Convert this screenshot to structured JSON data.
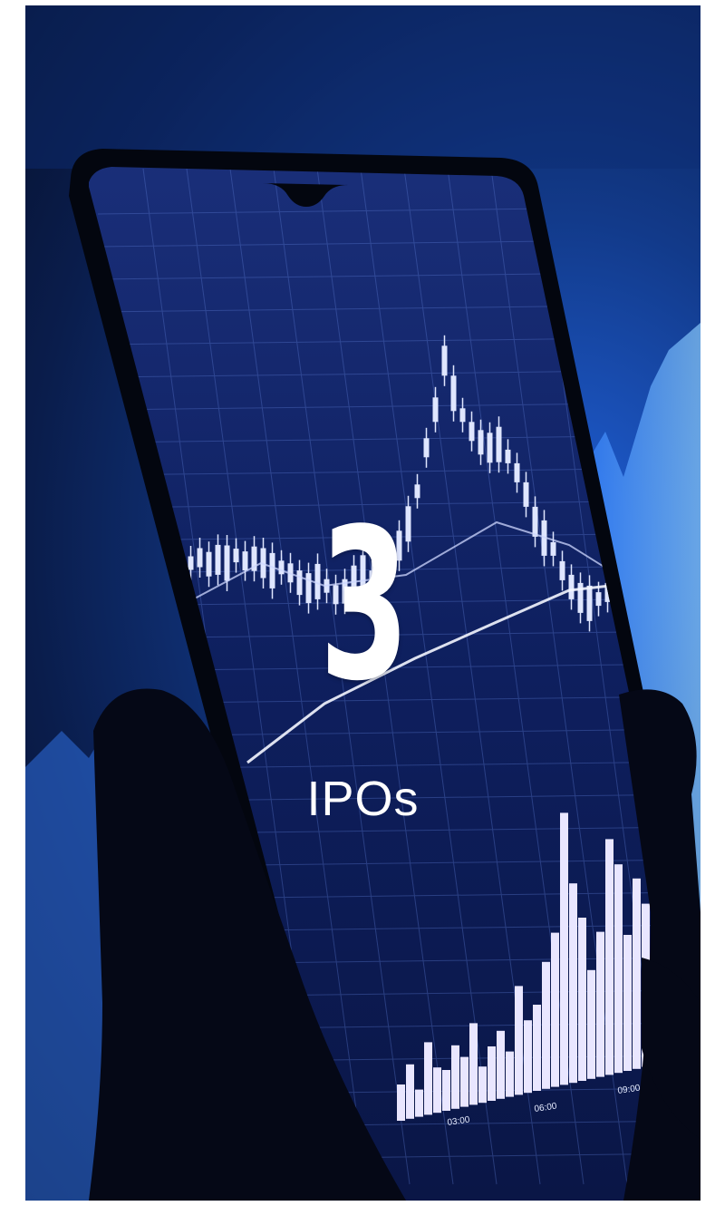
{
  "highlight": {
    "number": "3",
    "label": "IPOs"
  },
  "phone_chart": {
    "time_ticks": [
      "03:00",
      "06:00",
      "09:00"
    ]
  },
  "colors": {
    "background_dark": "#050d24",
    "background_blue": "#1f5fd6",
    "screen_navy": "#0b1646",
    "candles": "#dfe6ff",
    "text": "#ffffff"
  },
  "icons": [
    "phone-image",
    "hand-image"
  ]
}
